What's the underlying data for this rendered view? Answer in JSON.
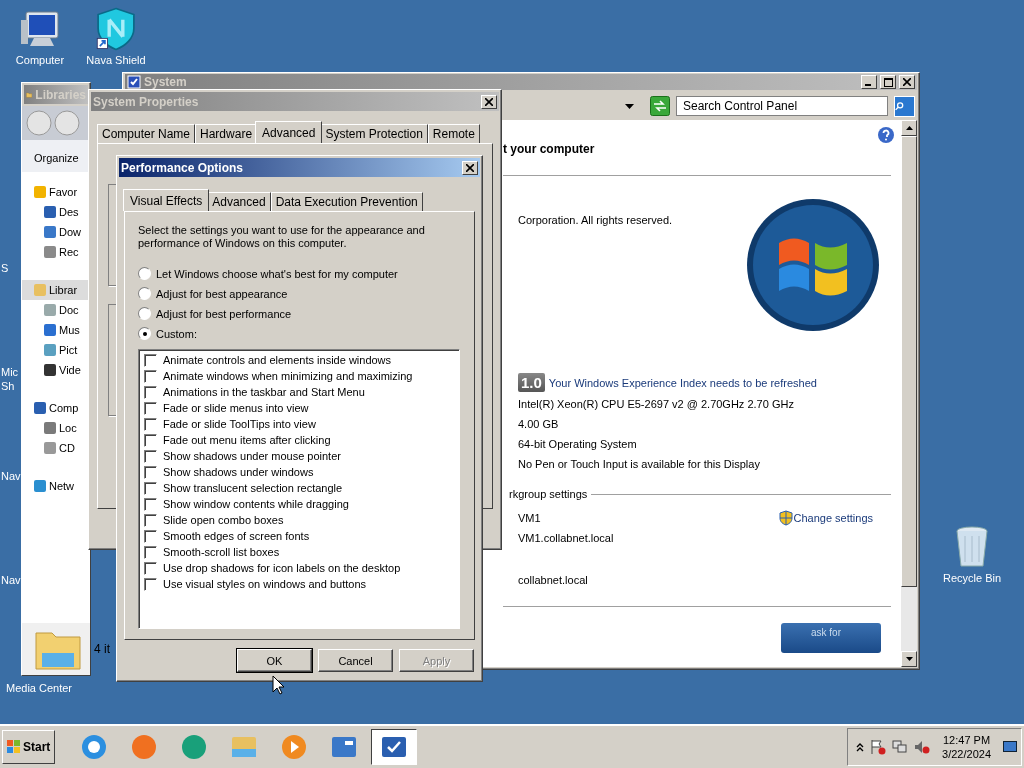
{
  "desktop": {
    "icons": [
      {
        "label": "Computer",
        "kind": "computer"
      },
      {
        "label": "Nava Shield",
        "kind": "shield"
      },
      {
        "label": "Recycle Bin",
        "kind": "bin"
      }
    ],
    "edge_labels": [
      "S",
      "Mic",
      "Sh",
      "Nav",
      "Nav"
    ],
    "media_center_label": "Media Center"
  },
  "libraries_window": {
    "title": "Libraries",
    "organize": "Organize",
    "nav": [
      {
        "label": "Favor",
        "kind": "star",
        "selected": false,
        "children": [
          {
            "label": "Des",
            "kind": "desktop",
            "selected": false
          },
          {
            "label": "Dow",
            "kind": "download",
            "selected": false
          },
          {
            "label": "Rec",
            "kind": "recent",
            "selected": false
          }
        ]
      },
      {
        "label": "Librar",
        "kind": "library",
        "selected": true,
        "children": [
          {
            "label": "Doc",
            "kind": "document",
            "selected": false
          },
          {
            "label": "Mus",
            "kind": "music",
            "selected": false
          },
          {
            "label": "Pict",
            "kind": "picture",
            "selected": false
          },
          {
            "label": "Vide",
            "kind": "video",
            "selected": false
          }
        ]
      },
      {
        "label": "Comp",
        "kind": "computer",
        "selected": false,
        "children": [
          {
            "label": "Loc",
            "kind": "drive",
            "selected": false
          },
          {
            "label": "CD",
            "kind": "disc",
            "selected": false
          }
        ]
      },
      {
        "label": "Netw",
        "kind": "network",
        "selected": false
      }
    ],
    "status": "4 it"
  },
  "system_window": {
    "title": "System",
    "search": {
      "placeholder": "Search Control Panel"
    },
    "heading": "t your computer",
    "copyright": "Corporation.  All rights reserved.",
    "wei": {
      "score": "1.0",
      "message": "Your Windows Experience Index needs to be refreshed"
    },
    "specs": [
      "Intel(R) Xeon(R) CPU E5-2697 v2 @ 2.70GHz   2.70 GHz",
      "4.00 GB",
      "64-bit Operating System",
      "No Pen or Touch Input is available for this Display"
    ],
    "group_title": "rkgroup settings",
    "computer_name": "VM1",
    "change_settings": "Change settings",
    "full_name": "VM1.collabnet.local",
    "domain": "collabnet.local",
    "genuine": "ask for"
  },
  "system_properties": {
    "title": "System Properties",
    "tabs": [
      {
        "label": "Computer Name",
        "selected": false
      },
      {
        "label": "Hardware",
        "selected": false
      },
      {
        "label": "Advanced",
        "selected": true
      },
      {
        "label": "System Protection",
        "selected": false
      },
      {
        "label": "Remote",
        "selected": false
      }
    ]
  },
  "performance_options": {
    "title": "Performance Options",
    "tabs": [
      {
        "label": "Visual Effects",
        "selected": true
      },
      {
        "label": "Advanced",
        "selected": false
      },
      {
        "label": "Data Execution Prevention",
        "selected": false
      }
    ],
    "intro": "Select the settings you want to use for the appearance and performance of Windows on this computer.",
    "options": [
      {
        "label": "Let Windows choose what's best for my computer",
        "selected": false
      },
      {
        "label": "Adjust for best appearance",
        "selected": false
      },
      {
        "label": "Adjust for best performance",
        "selected": false
      },
      {
        "label": "Custom:",
        "selected": true
      }
    ],
    "effects": [
      {
        "label": "Animate controls and elements inside windows",
        "checked": false
      },
      {
        "label": "Animate windows when minimizing and maximizing",
        "checked": false
      },
      {
        "label": "Animations in the taskbar and Start Menu",
        "checked": false
      },
      {
        "label": "Fade or slide menus into view",
        "checked": false
      },
      {
        "label": "Fade or slide ToolTips into view",
        "checked": false
      },
      {
        "label": "Fade out menu items after clicking",
        "checked": false
      },
      {
        "label": "Show shadows under mouse pointer",
        "checked": false
      },
      {
        "label": "Show shadows under windows",
        "checked": false
      },
      {
        "label": "Show translucent selection rectangle",
        "checked": false
      },
      {
        "label": "Show window contents while dragging",
        "checked": false
      },
      {
        "label": "Slide open combo boxes",
        "checked": false
      },
      {
        "label": "Smooth edges of screen fonts",
        "checked": false
      },
      {
        "label": "Smooth-scroll list boxes",
        "checked": false
      },
      {
        "label": "Use drop shadows for icon labels on the desktop",
        "checked": false
      },
      {
        "label": "Use visual styles on windows and buttons",
        "checked": false
      }
    ],
    "buttons": [
      {
        "label": "OK",
        "disabled": false
      },
      {
        "label": "Cancel",
        "disabled": false
      },
      {
        "label": "Apply",
        "disabled": true
      }
    ]
  },
  "taskbar": {
    "start": "Start",
    "apps": [
      {
        "kind": "browser-e",
        "active": false
      },
      {
        "kind": "fox",
        "active": false
      },
      {
        "kind": "globe",
        "active": false
      },
      {
        "kind": "folder",
        "active": false
      },
      {
        "kind": "media",
        "active": false
      },
      {
        "kind": "panel",
        "active": false
      },
      {
        "kind": "system",
        "active": true
      }
    ],
    "time": "12:47 PM",
    "date": "3/22/2024"
  }
}
